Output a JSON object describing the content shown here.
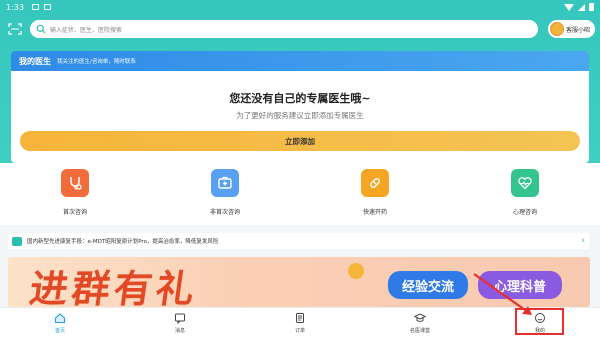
{
  "status_bar": {
    "time": "1:33"
  },
  "header": {
    "search_placeholder": "输入症状、医生、医院搜索",
    "assistant_label": "客服小昭"
  },
  "doctor_card": {
    "title": "我的医生",
    "subtitle": "我关注的医生/咨询单，随时联系",
    "empty_title": "您还没有自己的专属医生哦~",
    "empty_subtitle": "为了更好的服务建议立即添加专属医生",
    "add_button": "立即添加"
  },
  "services": [
    {
      "label": "首次咨询",
      "icon": "stethoscope-icon",
      "color": "#f26b3a"
    },
    {
      "label": "非首次咨询",
      "icon": "medical-kit-icon",
      "color": "#5aa0f2"
    },
    {
      "label": "快速开药",
      "icon": "pill-icon",
      "color": "#f5a524"
    },
    {
      "label": "心理咨询",
      "icon": "heart-pulse-icon",
      "color": "#34c48f"
    }
  ],
  "notice": {
    "text": "国内新型先进康复手段：e-MDT昭阳复原计划Pro，提高治愈率，降低复发风险"
  },
  "banner": {
    "title": "进群有礼",
    "bubble1": "经验交流",
    "bubble2": "心理科普"
  },
  "bottom_nav": [
    {
      "label": "首页",
      "icon": "home-icon",
      "active": true
    },
    {
      "label": "消息",
      "icon": "message-icon",
      "active": false
    },
    {
      "label": "订单",
      "icon": "order-icon",
      "active": false
    },
    {
      "label": "名医课堂",
      "icon": "graduation-cap-icon",
      "active": false
    },
    {
      "label": "我的",
      "icon": "smile-icon",
      "active": false
    }
  ],
  "colors": {
    "teal": "#36c6bd",
    "header_blue": "#2f8be6",
    "add_button": "#f7b43a",
    "active_nav": "#2a9fd8",
    "annotation_red": "#e8312f"
  }
}
